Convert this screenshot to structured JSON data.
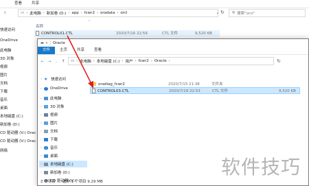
{
  "bg_window": {
    "tabs": [
      "查看",
      "共享"
    ],
    "breadcrumb": [
      "此电脑",
      "新加卷 (D:)",
      "app",
      "fcwr2",
      "oradata",
      "orcl"
    ],
    "search_placeholder": "搜索\"orcl\"",
    "columns": {
      "name": "名称"
    },
    "file": {
      "name": "CONTROL01.CTL",
      "date": "2020/7/16 22:59",
      "type": "CTL 文件",
      "size": "9,520 KB"
    },
    "sidebar": [
      "快速访问",
      "OneDrive",
      "此电脑",
      "3D 对象",
      "视频",
      "图片",
      "文档",
      "下载",
      "音乐",
      "桌面",
      "本地磁盘 (C:)",
      "新加卷 (D:)",
      "CD 驱动器 (V:) Orac",
      "CD 驱动器 (V:) Orac",
      "网络"
    ]
  },
  "fg_window": {
    "title": "Oracle",
    "tabs": [
      "文件",
      "主页",
      "共享",
      "查看"
    ],
    "breadcrumb": [
      "此电脑",
      "本地磁盘 (C:)",
      "用户",
      "fcwr2",
      "Oracle"
    ],
    "sidebar": [
      {
        "label": "快速访问",
        "icon": "star-icon",
        "color": "#2b7cd3"
      },
      {
        "label": "OneDrive",
        "icon": "cloud-icon",
        "color": "#2b7cd3"
      },
      {
        "label": "此电脑",
        "icon": "computer-icon",
        "color": "#4a90d9"
      },
      {
        "label": "3D 对象",
        "icon": "cube-icon",
        "color": "#5aa0e0"
      },
      {
        "label": "视频",
        "icon": "video-icon",
        "color": "#6b7fa0"
      },
      {
        "label": "图片",
        "icon": "picture-icon",
        "color": "#5aa0e0"
      },
      {
        "label": "文档",
        "icon": "document-icon",
        "color": "#8a9bb0"
      },
      {
        "label": "下载",
        "icon": "download-icon",
        "color": "#2b7cd3"
      },
      {
        "label": "音乐",
        "icon": "music-icon",
        "color": "#3a8ad8"
      },
      {
        "label": "桌面",
        "icon": "desktop-icon",
        "color": "#3a8ad8"
      },
      {
        "label": "本地磁盘 (C:)",
        "icon": "drive-icon",
        "color": "#7a8a9a"
      },
      {
        "label": "新加卷 (D:)",
        "icon": "drive-icon",
        "color": "#7a8a9a"
      },
      {
        "label": "CD 驱动器 (V:)",
        "icon": "cd-icon",
        "color": "#7a8a9a"
      }
    ],
    "files": [
      {
        "name": "oradiag_fcwr2",
        "date": "2020/7/15 21:38",
        "type": "文件夹",
        "size": "",
        "kind": "folder"
      },
      {
        "name": "CONTROL03.CTL",
        "date": "2020/7/19 22:53",
        "type": "CTL 文件",
        "size": "9,520 KB",
        "kind": "file"
      }
    ],
    "status_count": "2 个项目",
    "status_selected": "选中 1 个项目  9.29 MB"
  },
  "watermark": "软件技巧"
}
